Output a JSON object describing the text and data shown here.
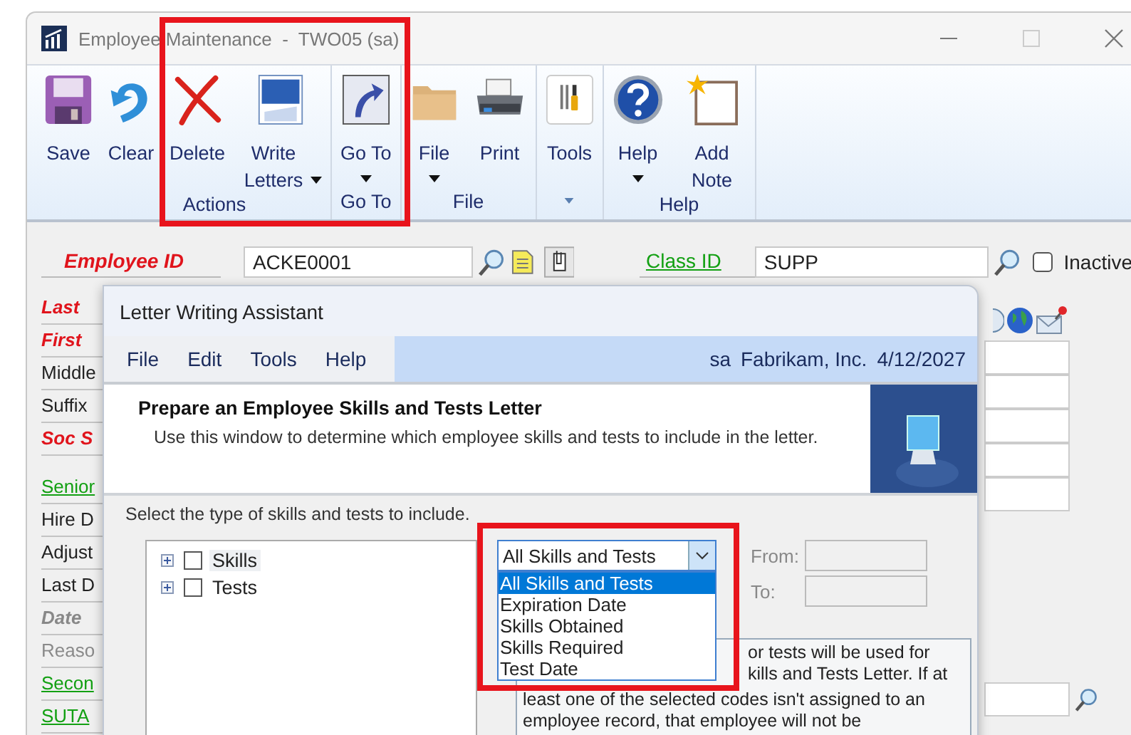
{
  "window": {
    "title": "Employee Maintenance  -  TWO05 (sa)"
  },
  "ribbon": {
    "groups": [
      {
        "kind": "labeled",
        "label": "Actions",
        "buttons": [
          {
            "label": "Save"
          },
          {
            "label": "Clear"
          },
          {
            "label": "Delete"
          },
          {
            "label": "Write Letters",
            "dropdown": true
          }
        ]
      },
      {
        "kind": "labeled",
        "label": "Go To",
        "buttons": [
          {
            "label": "Go To",
            "dropdown": true
          }
        ]
      },
      {
        "kind": "labeled",
        "label": "File",
        "buttons": [
          {
            "label": "File",
            "dropdown": true
          },
          {
            "label": "Print"
          }
        ]
      },
      {
        "kind": "menu",
        "buttons": [
          {
            "label": "Tools"
          }
        ]
      },
      {
        "kind": "labeled",
        "label": "Help",
        "buttons": [
          {
            "label": "Help",
            "dropdown": true
          },
          {
            "label": "Add Note"
          }
        ]
      }
    ]
  },
  "form": {
    "employee_id": {
      "label": "Employee ID",
      "value": "ACKE0001"
    },
    "class_id": {
      "label": "Class ID",
      "value": "SUPP"
    },
    "inactive": {
      "label": "Inactive",
      "checked": false
    },
    "label_sections": [
      {
        "labels": [
          {
            "text": "Last",
            "kind": "required"
          },
          {
            "text": "First",
            "kind": "required"
          },
          {
            "text": "Middle",
            "kind": "plain"
          },
          {
            "text": "Suffix",
            "kind": "plain"
          },
          {
            "text": "Soc S",
            "kind": "required"
          }
        ]
      },
      {
        "labels": [
          {
            "text": "Senior",
            "kind": "link"
          },
          {
            "text": "Hire D",
            "kind": "plain"
          },
          {
            "text": "Adjust",
            "kind": "plain"
          },
          {
            "text": "Last D",
            "kind": "plain"
          },
          {
            "text": "Date",
            "kind": "muted_bold"
          },
          {
            "text": "Reaso",
            "kind": "muted"
          },
          {
            "text": "Secon",
            "kind": "link"
          },
          {
            "text": "SUTA",
            "kind": "link"
          }
        ]
      }
    ]
  },
  "dialog": {
    "title": "Letter Writing Assistant",
    "menu": [
      "File",
      "Edit",
      "Tools",
      "Help"
    ],
    "status": {
      "user": "sa",
      "company": "Fabrikam, Inc.",
      "date": "4/12/2027"
    },
    "header": {
      "title": "Prepare an Employee Skills and Tests Letter",
      "subtitle": "Use this window to determine which employee skills and tests to include in the letter."
    },
    "instruction": "Select the type of skills and tests to include.",
    "tree": [
      {
        "label": "Skills",
        "checked": false,
        "expanded": false
      },
      {
        "label": "Tests",
        "checked": false,
        "expanded": false
      }
    ],
    "combo": {
      "value": "All Skills and Tests",
      "open": true,
      "options": [
        {
          "label": "All Skills and Tests",
          "selected": true
        },
        {
          "label": "Expiration Date",
          "selected": false
        },
        {
          "label": "Skills Obtained",
          "selected": false
        },
        {
          "label": "Skills Required",
          "selected": false
        },
        {
          "label": "Test Date",
          "selected": false
        }
      ]
    },
    "from": {
      "label": "From:"
    },
    "to": {
      "label": "To:"
    },
    "description_lines": [
      {
        "text": "or tests will be used for",
        "kind": "partial"
      },
      {
        "text": "kills and Tests Letter. If at",
        "kind": "partial"
      },
      {
        "text": "least one of the selected codes isn't assigned to an",
        "kind": "full"
      },
      {
        "text": "employee record, that employee will not be",
        "kind": "full"
      }
    ]
  }
}
